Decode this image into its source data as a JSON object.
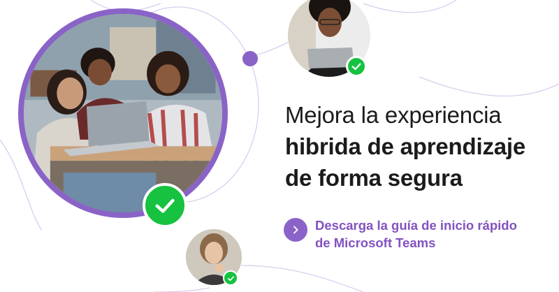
{
  "headline": {
    "line1": "Mejora la experiencia",
    "line2": "hibrida de aprendizaje",
    "line3": "de forma segura"
  },
  "cta": {
    "line1": "Descarga la guía de inicio rápido",
    "line2": "de Microsoft Teams",
    "icon": "chevron-right-icon"
  },
  "colors": {
    "accent_purple": "#8a63c7",
    "cta_text": "#8352c0",
    "check_green": "#16c23f",
    "text_dark": "#1b1b1b"
  }
}
